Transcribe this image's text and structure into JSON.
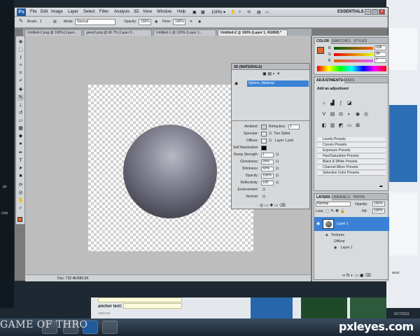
{
  "photoshop": {
    "logo": "Ps",
    "menu": [
      "File",
      "Edit",
      "Image",
      "Layer",
      "Select",
      "Filter",
      "Analysis",
      "3D",
      "View",
      "Window",
      "Help"
    ],
    "workspace": "ESSENTIALS",
    "options_bar": {
      "brush_label": "Brush:",
      "brush_size": "1",
      "mode_label": "Mode:",
      "mode_value": "Normal",
      "opacity_label": "Opacity:",
      "opacity_value": "100%",
      "flow_label": "Flow:",
      "flow_value": "100%"
    },
    "tabs": [
      "Untitled-2.png @ 100% (Layer...",
      "gone2.png @ 66.7% (Layer 0...",
      "Untitled-1 @ 100% (Layer 1...",
      "Untitled-2 @ 100% (Layer 1, RGB/8) *"
    ],
    "status_doc": "Doc: 732.4K/680.6K",
    "panel_3d": {
      "title": "3D {MATERIALS}",
      "material": "Sphere_Material",
      "props": {
        "ambient": "Ambient:",
        "refraction_label": "Refraction:",
        "refraction_value": "1",
        "specular": "Specular:",
        "two_sided": "Two Sided",
        "diffuse": "Diffuse:",
        "diffuse_file": "Layer 1.psd",
        "self_illum": "Self Illumination:",
        "bump_label": "Bump Strength:",
        "bump_value": "1",
        "gloss_label": "Glossiness:",
        "gloss_value": "20%",
        "shin_label": "Shininess:",
        "shin_value": "60%",
        "opacity_label": "Opacity:",
        "opacity_value": "100%",
        "refl_label": "Reflectivity:",
        "refl_value": "100",
        "env_label": "Environment:",
        "normal_label": "Normal:"
      }
    },
    "color_panel": {
      "tabs": [
        "COLOR",
        "SWATCHES",
        "STYLES"
      ],
      "r": "228",
      "g": "94",
      "b": "7"
    },
    "adjustments": {
      "tabs": [
        "ADJUSTMENTS",
        "MASKS"
      ],
      "heading": "Add an adjustment",
      "presets": [
        "Levels Presets",
        "Curves Presets",
        "Exposure Presets",
        "Hue/Saturation Presets",
        "Black & White Presets",
        "Channel Mixer Presets",
        "Selective Color Presets"
      ]
    },
    "layers": {
      "tabs": [
        "LAYERS",
        "CHANNELS",
        "PATHS"
      ],
      "blend": "Normal",
      "opacity_label": "Opacity:",
      "opacity_value": "100%",
      "lock_label": "Lock:",
      "fill_label": "Fill:",
      "fill_value": "100%",
      "layer_name": "Layer 1",
      "textures": "Textures",
      "diffuse": "Diffuse",
      "sub_layer": "Layer 1"
    }
  },
  "web": {
    "anchor_label": "anchor text:",
    "optional": "optional"
  },
  "desktop": {
    "logo_text": "GAME OF THRO",
    "watermark": "pxleyes.com",
    "clock": "6/17/2011",
    "left_fragments": [
      "go",
      "Unti"
    ],
    "right_fragment": "aces"
  },
  "colors": {
    "foreground": "#e0672a",
    "selection": "#3b82d6"
  }
}
